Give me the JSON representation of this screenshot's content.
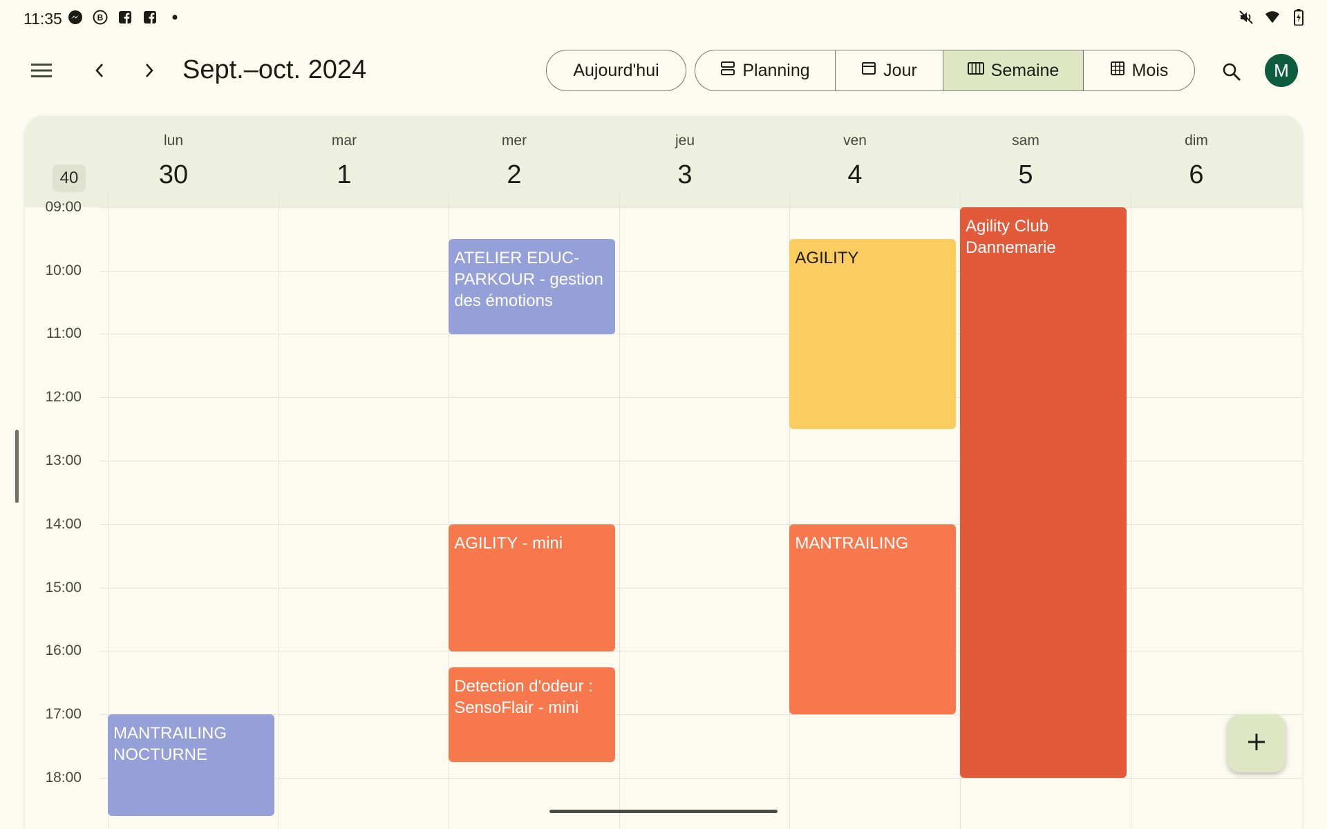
{
  "status_bar": {
    "time": "11:35",
    "left_icons": [
      "messenger-icon",
      "b-circle-icon",
      "facebook-icon",
      "facebook-icon",
      "dot-icon"
    ],
    "right_icons": [
      "mute-icon",
      "wifi-icon",
      "battery-icon"
    ]
  },
  "header": {
    "title": "Sept.–oct. 2024",
    "today_label": "Aujourd'hui",
    "views": [
      {
        "label": "Planning",
        "icon": "agenda-icon",
        "active": false
      },
      {
        "label": "Jour",
        "icon": "day-view-icon",
        "active": false
      },
      {
        "label": "Semaine",
        "icon": "week-view-icon",
        "active": true
      },
      {
        "label": "Mois",
        "icon": "month-view-icon",
        "active": false
      }
    ],
    "avatar_initial": "M"
  },
  "calendar": {
    "week_number": "40",
    "days": [
      {
        "name": "lun",
        "num": "30"
      },
      {
        "name": "mar",
        "num": "1"
      },
      {
        "name": "mer",
        "num": "2"
      },
      {
        "name": "jeu",
        "num": "3"
      },
      {
        "name": "ven",
        "num": "4"
      },
      {
        "name": "sam",
        "num": "5"
      },
      {
        "name": "dim",
        "num": "6"
      }
    ],
    "hours": [
      "09:00",
      "10:00",
      "11:00",
      "12:00",
      "13:00",
      "14:00",
      "15:00",
      "16:00",
      "17:00",
      "18:00"
    ],
    "events": [
      {
        "title": "ATELIER EDUC-PARKOUR - gestion des émotions",
        "day": 2,
        "start": 9.5,
        "end": 11.0,
        "color": "#959fd8"
      },
      {
        "title": "AGILITY - mini",
        "day": 2,
        "start": 14.0,
        "end": 16.0,
        "color": "#f7784d"
      },
      {
        "title": "Detection d'odeur : SensoFlair - mini",
        "day": 2,
        "start": 16.25,
        "end": 17.75,
        "color": "#f7784d"
      },
      {
        "title": "AGILITY",
        "day": 4,
        "start": 9.5,
        "end": 12.5,
        "color": "#fbcc5f"
      },
      {
        "title": "MANTRAILING",
        "day": 4,
        "start": 14.0,
        "end": 17.0,
        "color": "#f7784d"
      },
      {
        "title": "Agility Club Dannemarie",
        "day": 5,
        "start": 9.0,
        "end": 18.0,
        "color": "#e35a3a"
      },
      {
        "title": "MANTRAILING NOCTURNE",
        "day": 0,
        "start": 17.0,
        "end": 18.6,
        "color": "#959fd8"
      }
    ]
  },
  "colors": {
    "accent": "#dfe6c3",
    "avatar_bg": "#0d5c3f",
    "background": "#fdfbef",
    "header_bg": "#edefdf"
  }
}
